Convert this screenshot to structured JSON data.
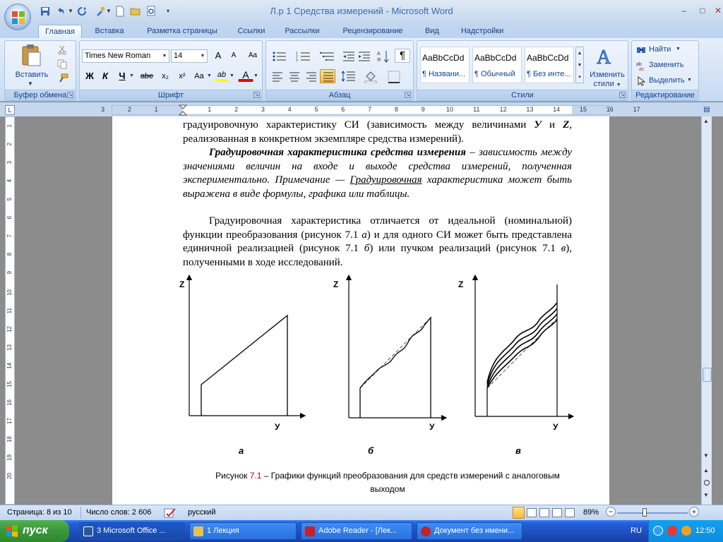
{
  "window": {
    "title": "Л.р 1 Средства измерений - Microsoft Word",
    "controls": {
      "minimize": "–",
      "maximize": "□",
      "close": "✕"
    },
    "doc_controls": {
      "minimize": "–",
      "restore": "❐",
      "close": "✕"
    }
  },
  "tabs": [
    {
      "label": "Главная",
      "active": true
    },
    {
      "label": "Вставка"
    },
    {
      "label": "Разметка страницы"
    },
    {
      "label": "Ссылки"
    },
    {
      "label": "Рассылки"
    },
    {
      "label": "Рецензирование"
    },
    {
      "label": "Вид"
    },
    {
      "label": "Надстройки"
    }
  ],
  "help_label": "?",
  "ribbon": {
    "clipboard": {
      "label": "Буфер обмена",
      "paste": "Вставить"
    },
    "font": {
      "label": "Шрифт",
      "font_name": "Times New Roman",
      "font_size": "14",
      "grow": "A",
      "shrink": "A",
      "clear": "Aa",
      "bold": "Ж",
      "italic": "К",
      "underline": "Ч",
      "strike": "abe",
      "subscript": "x₂",
      "superscript": "x²",
      "case": "Aa",
      "highlight": "ab",
      "font_color": "A"
    },
    "paragraph": {
      "label": "Абзац",
      "show_marks": "¶"
    },
    "styles": {
      "label": "Стили",
      "items": [
        {
          "sample": "AaBbCcDd",
          "name": "¶ Названи..."
        },
        {
          "sample": "AaBbCcDd",
          "name": "¶ Обычный"
        },
        {
          "sample": "AaBbCcDd",
          "name": "¶ Без инте..."
        }
      ],
      "change_styles_line1": "Изменить",
      "change_styles_line2": "стили"
    },
    "editing": {
      "label": "Редактирование",
      "find": "Найти",
      "replace": "Заменить",
      "select": "Выделить"
    }
  },
  "ruler": {
    "corner": "L",
    "h_ticks": [
      "3",
      "2",
      "1",
      "1",
      "2",
      "3",
      "4",
      "5",
      "6",
      "7",
      "8",
      "9",
      "10",
      "11",
      "12",
      "13",
      "14",
      "15",
      "16",
      "17"
    ],
    "v_ticks": [
      "1",
      "2",
      "3",
      "4",
      "5",
      "6",
      "7",
      "8",
      "9",
      "10",
      "11",
      "12",
      "13",
      "14",
      "15",
      "16",
      "17",
      "18",
      "19",
      "20"
    ]
  },
  "document": {
    "p1": {
      "text_a": "градуировочную характеристику СИ (зависимость между величинами ",
      "var_y": "У",
      "text_and": " и ",
      "var_z": "Z",
      "text_b": ", реализованная в конкретном экземпляре средства измерений)."
    },
    "p2": {
      "term": "Градуировочная характеристика средства измерения",
      "text_a": " – зависимость между значениями величин на входе и выходе средства измерений, полученная экспериментально. Примечание — ",
      "text_underlined": "Градуировочная",
      "text_b": " характеристика может быть выражена в виде формулы, графика или таблицы."
    },
    "p3": {
      "text_a": "Градуировочная характеристика отличается от идеальной (номинальной) функции преобразования (рисунок 7.1 ",
      "ref_a": "а",
      "text_b": ") и для одного СИ может быть представлена единичной реализацией (рисунок 7.1 ",
      "ref_b": "б",
      "text_c": ") или пучком реализаций (рисунок 7.1 ",
      "ref_c": "в",
      "text_d": "), полученными в ходе исследований."
    },
    "figure": {
      "panels": [
        {
          "y_label": "Z",
          "x_label": "У",
          "caption": "а"
        },
        {
          "y_label": "Z",
          "x_label": "У",
          "caption": "б"
        },
        {
          "y_label": "Z",
          "x_label": "У",
          "caption": "в"
        }
      ],
      "caption_prefix": "Рисунок ",
      "caption_number": "7.1",
      "caption_text_line1": " – Графики функций преобразования для средств измерений с аналоговым",
      "caption_text_line2": "выходом"
    }
  },
  "statusbar": {
    "page": "Страница: 8 из 10",
    "words": "Число слов: 2 606",
    "language": "русский",
    "zoom": "89%",
    "zoom_minus": "−",
    "zoom_plus": "+"
  },
  "taskbar": {
    "start": "пуск",
    "tasks": [
      {
        "label": "3 Microsoft Office ...",
        "color": "#2b579a"
      },
      {
        "label": "1 Лекция",
        "color": "#e8c250"
      },
      {
        "label": "Adobe Reader - [Лек...",
        "color": "#c8202a"
      },
      {
        "label": "Документ без имени...",
        "color": "#c8202a"
      }
    ],
    "language": "RU",
    "clock": "12:50"
  },
  "colors": {
    "caption_number": "#c00000",
    "taskbar": "#245edb",
    "start": "#3c9a3a"
  }
}
